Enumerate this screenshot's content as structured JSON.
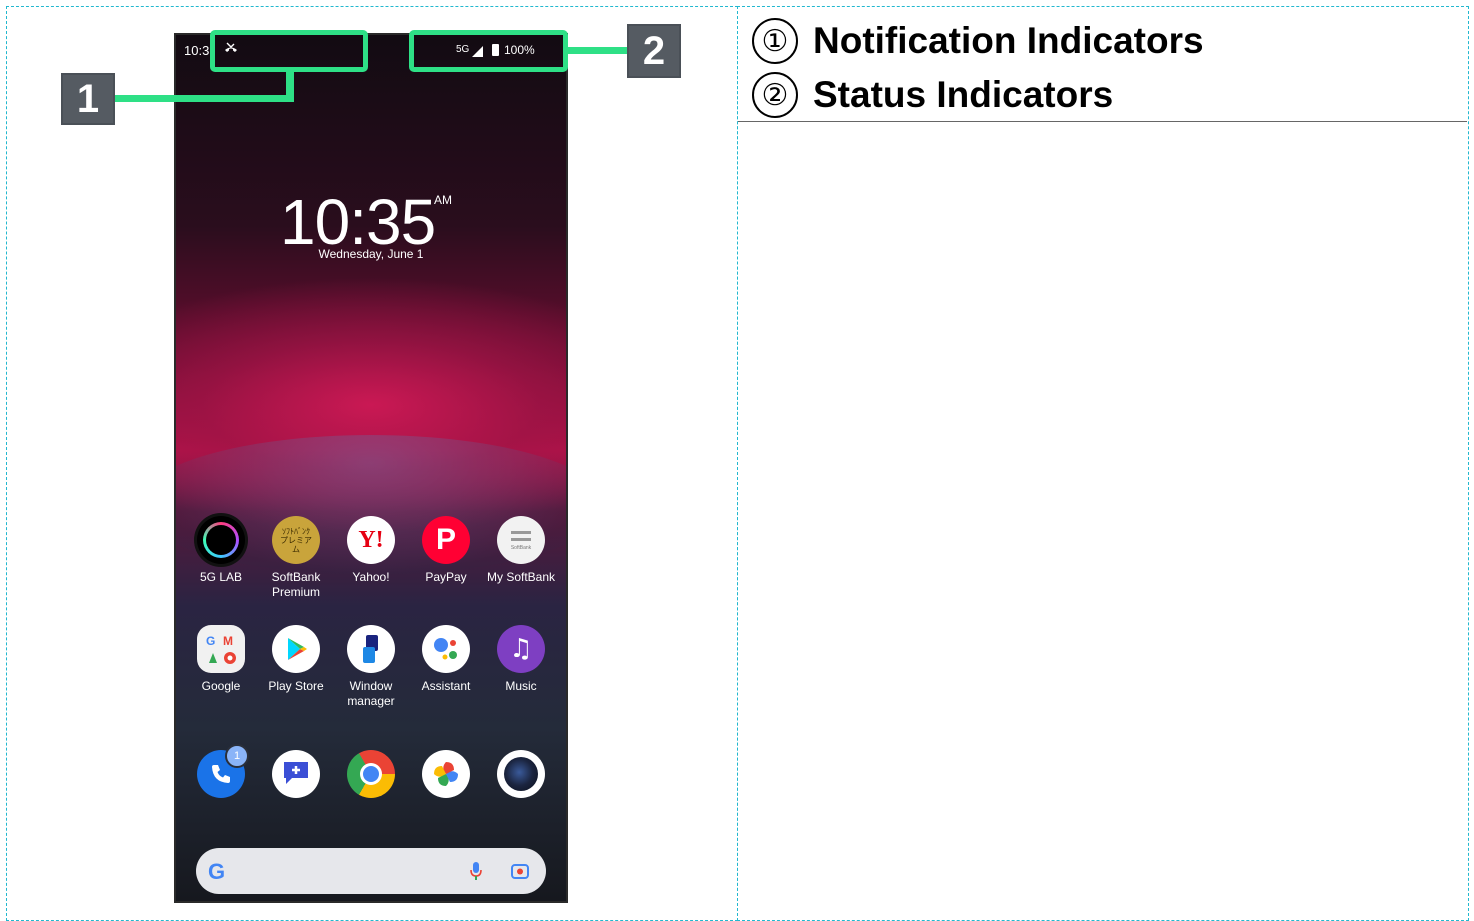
{
  "legend": {
    "items": [
      {
        "num": "①",
        "text": "Notification Indicators"
      },
      {
        "num": "②",
        "text": "Status Indicators"
      }
    ]
  },
  "callouts": {
    "one": "1",
    "two": "2"
  },
  "phone": {
    "status_bar": {
      "time": "10:3",
      "network": "5G",
      "battery": "100%"
    },
    "lock_clock": {
      "time": "10:35",
      "ampm": "AM",
      "date": "Wednesday, June 1"
    },
    "apps_row1": [
      {
        "label": "5G LAB"
      },
      {
        "label": "SoftBank Premium",
        "icon_text": "ｿﾌﾄﾊﾞﾝｸ プレミアム"
      },
      {
        "label": "Yahoo!",
        "icon_text": "Y!"
      },
      {
        "label": "PayPay",
        "icon_text": "P"
      },
      {
        "label": "My SoftBank",
        "icon_text": "SoftBank"
      }
    ],
    "apps_row2": [
      {
        "label": "Google"
      },
      {
        "label": "Play Store"
      },
      {
        "label": "Window manager"
      },
      {
        "label": "Assistant"
      },
      {
        "label": "Music",
        "icon_text": "♫"
      }
    ],
    "dock": [
      {
        "name": "phone",
        "badge": "1"
      },
      {
        "name": "messages"
      },
      {
        "name": "chrome"
      },
      {
        "name": "photos"
      },
      {
        "name": "camera"
      }
    ],
    "search": {
      "logo": "G"
    }
  },
  "colors": {
    "callout_green": "#2ee086",
    "callout_box": "#555b62",
    "cell_border": "#22b8cf"
  }
}
